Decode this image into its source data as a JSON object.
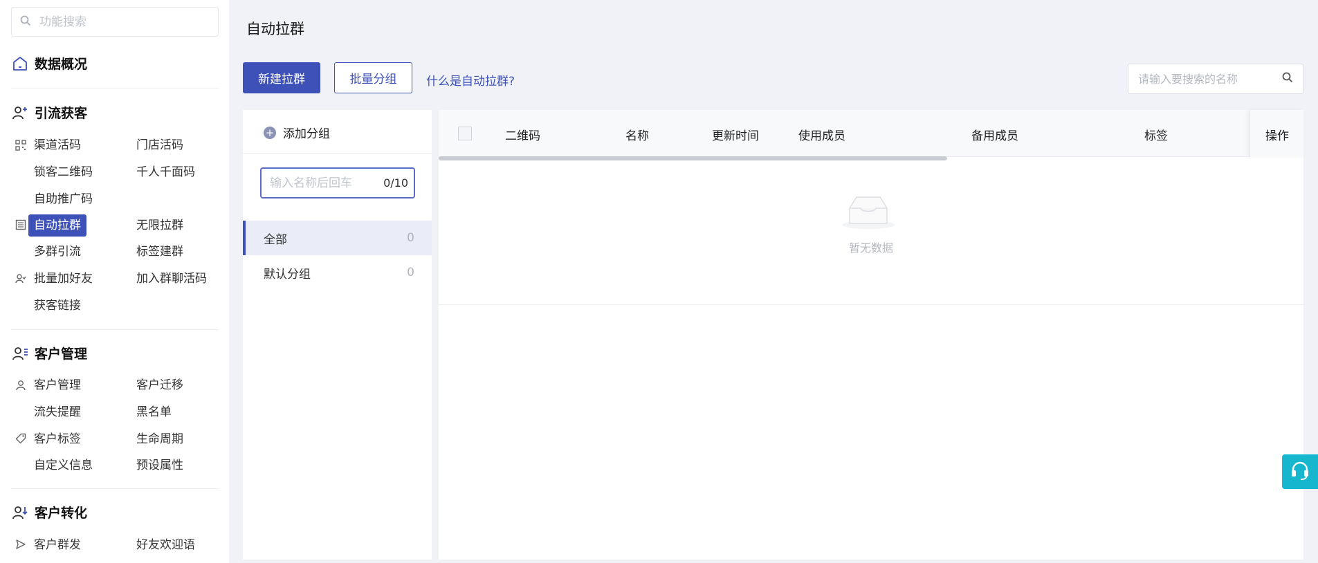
{
  "sidebar": {
    "search_placeholder": "功能搜索",
    "sections": [
      {
        "title": "数据概况"
      },
      {
        "title": "引流获客",
        "items": [
          "渠道活码",
          "门店活码",
          "锁客二维码",
          "千人千面码",
          "自助推广码",
          "自动拉群",
          "无限拉群",
          "多群引流",
          "标签建群",
          "批量加好友",
          "加入群聊活码",
          "获客链接"
        ]
      },
      {
        "title": "客户管理",
        "items": [
          "客户管理",
          "客户迁移",
          "流失提醒",
          "黑名单",
          "客户标签",
          "生命周期",
          "自定义信息",
          "预设属性"
        ]
      },
      {
        "title": "客户转化",
        "items": [
          "客户群发",
          "好友欢迎语"
        ]
      }
    ],
    "active_item": "自动拉群"
  },
  "page": {
    "title": "自动拉群",
    "new_button": "新建拉群",
    "batch_group_button": "批量分组",
    "help_link": "什么是自动拉群?",
    "search_placeholder": "请输入要搜索的名称"
  },
  "groups": {
    "add_label": "添加分组",
    "input_placeholder": "输入名称后回车",
    "input_count": "0/10",
    "list": [
      {
        "name": "全部",
        "count": "0"
      },
      {
        "name": "默认分组",
        "count": "0"
      }
    ]
  },
  "table": {
    "columns": [
      "二维码",
      "名称",
      "更新时间",
      "使用成员",
      "备用成员",
      "标签",
      "操作"
    ],
    "rows": [],
    "empty_text": "暂无数据"
  },
  "colors": {
    "primary": "#3d51b8",
    "support": "#17b6cf"
  }
}
